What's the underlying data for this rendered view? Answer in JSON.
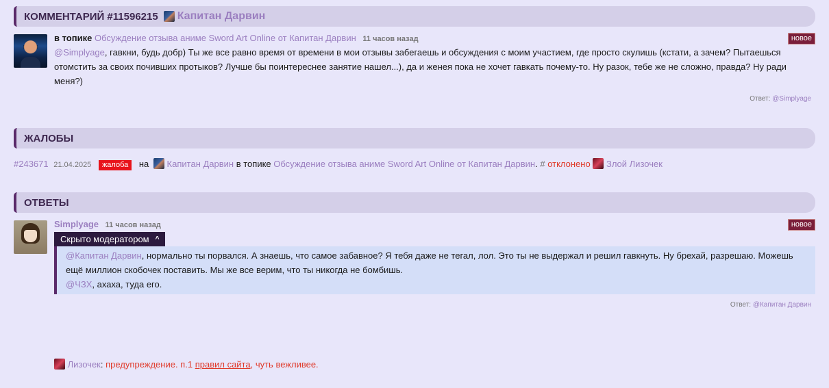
{
  "comment": {
    "header_title": "КОММЕНТАРИЙ #11596215",
    "header_author": "Капитан Дарвин",
    "in_topic_label": "в топике",
    "topic_link": "Обсуждение отзыва аниме Sword Art Online от Капитан Дарвин",
    "time": "11 часов назад",
    "badge": "новое",
    "mention": "@Simplyage",
    "text": ", гавкни, будь добр) Ты же все равно время от времени в мои отзывы забегаешь и обсуждения с моим участием, где просто скулишь (кстати, а зачем? Пытаешься отомстить за своих почивших протыков? Лучше бы поинтереснее занятие нашел...), да и женея пока не хочет гавкать почему-то. Ну разок, тебе же не сложно, правда? Ну ради меня?)",
    "reply_label": "Ответ:",
    "reply_user": "@Simplyage"
  },
  "complaints": {
    "header_title": "ЖАЛОБЫ",
    "number": "#243671",
    "date": "21.04.2025",
    "badge": "жалоба",
    "on_label": "на",
    "target_user": "Капитан Дарвин",
    "in_topic_label": "в топике",
    "topic_link": "Обсуждение отзыва аниме Sword Art Online от Капитан Дарвин",
    "dot": ".",
    "hash": "#",
    "status": "отклонено",
    "moderator": "Злой Лизочек"
  },
  "answers": {
    "header_title": "ОТВЕТЫ",
    "author": "Simplyage",
    "time": "11 часов назад",
    "badge": "новое",
    "hidden_label": "Скрыто модератором",
    "hidden_chevron": "^",
    "line1_mention": "@Капитан Дарвин",
    "line1_text": ", нормально ты порвался. А знаешь, что самое забавное? Я тебя даже не тегал, лол. Это ты не выдержал и решил гавкнуть. Ну брехай, разрешаю. Можешь ещё миллион скобочек поставить. Мы же все верим, что ты никогда не бомбишь.",
    "line2_mention": "@ЧЗХ",
    "line2_text": ", ахаха, туда его.",
    "reply_label": "Ответ:",
    "reply_user": "@Капитан Дарвин"
  },
  "moderation_note": {
    "moderator": "Лизочек",
    "colon": ":",
    "warning_text": "предупреждение. п.1",
    "rules_link": "правил сайта",
    "tail": ", чуть вежливее."
  }
}
